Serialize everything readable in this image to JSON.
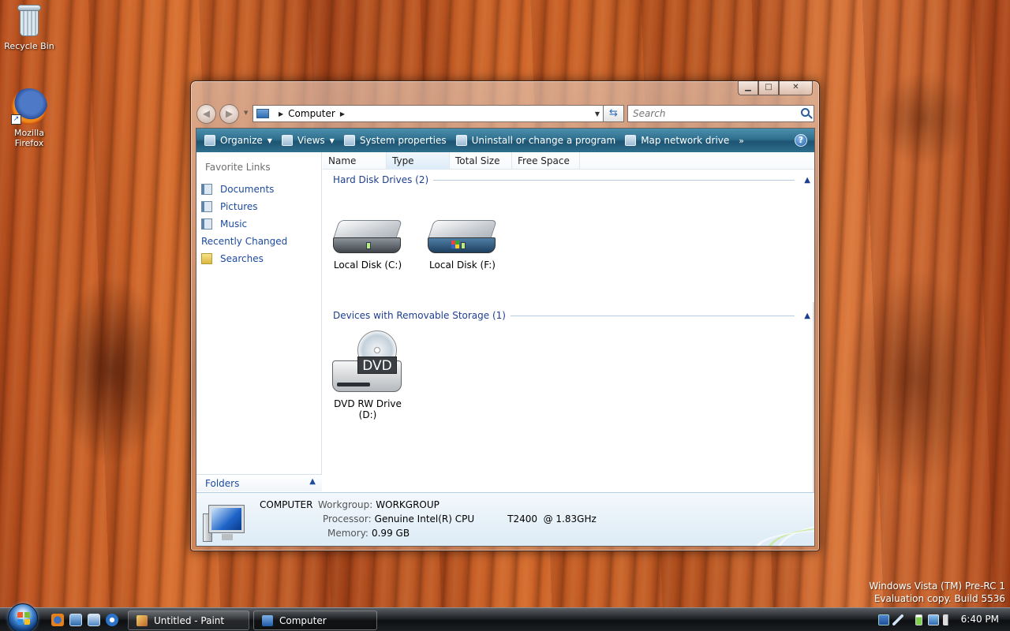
{
  "desktop": {
    "icons": [
      {
        "label": "Recycle Bin",
        "icon": "recycle-bin-icon"
      },
      {
        "label": "Mozilla Firefox",
        "icon": "firefox-icon"
      }
    ],
    "watermark": {
      "line1": "Windows Vista (TM) Pre-RC 1",
      "line2": "Evaluation copy. Build 5536"
    }
  },
  "window": {
    "title": "Computer",
    "controls": {
      "minimize": "▁",
      "maximize": "□",
      "close": "✕"
    },
    "address": {
      "crumb": "Computer"
    },
    "search": {
      "placeholder": "Search"
    },
    "toolbar": {
      "items": [
        {
          "label": "Organize",
          "icon": "organize-icon",
          "dropdown": true
        },
        {
          "label": "Views",
          "icon": "views-icon",
          "dropdown": true
        },
        {
          "label": "System properties",
          "icon": "system-properties-icon",
          "dropdown": false
        },
        {
          "label": "Uninstall or change a program",
          "icon": "uninstall-icon",
          "dropdown": false
        },
        {
          "label": "Map network drive",
          "icon": "map-network-drive-icon",
          "dropdown": false
        }
      ],
      "more": "»",
      "help": "?"
    },
    "nav_pane": {
      "title": "Favorite Links",
      "links": [
        {
          "label": "Documents",
          "icon": "documents-icon"
        },
        {
          "label": "Pictures",
          "icon": "pictures-icon"
        },
        {
          "label": "Music",
          "icon": "music-icon"
        },
        {
          "label": "Recently Changed",
          "icon": "recently-changed-icon"
        },
        {
          "label": "Searches",
          "icon": "searches-folder-icon"
        }
      ],
      "folders_label": "Folders"
    },
    "columns": [
      "Name",
      "Type",
      "Total Size",
      "Free Space"
    ],
    "groups": [
      {
        "title": "Hard Disk Drives (2)",
        "items": [
          {
            "label": "Local Disk (C:)",
            "icon": "hard-disk-icon"
          },
          {
            "label": "Local Disk (F:)",
            "icon": "windows-hard-disk-icon"
          }
        ]
      },
      {
        "title": "Devices with Removable Storage (1)",
        "items": [
          {
            "label": "DVD RW Drive (D:)",
            "icon": "dvd-drive-icon",
            "badge": "DVD"
          }
        ]
      }
    ],
    "details": {
      "name": "COMPUTER",
      "workgroup_key": "Workgroup:",
      "workgroup": "WORKGROUP",
      "processor_key": "Processor:",
      "processor": "Genuine Intel(R) CPU           T2400  @ 1.83GHz",
      "memory_key": "Memory:",
      "memory": "0.99 GB"
    }
  },
  "taskbar": {
    "tasks": [
      {
        "label": "Untitled - Paint",
        "icon": "paint-icon",
        "active": false
      },
      {
        "label": "Computer",
        "icon": "computer-icon",
        "active": true
      }
    ],
    "clock": "6:40 PM"
  },
  "colors": {
    "toolbar": "#2f6f8e",
    "link": "#1d4ba0",
    "group_header": "#1e3f8f",
    "taskbar": "#1c1f22"
  }
}
